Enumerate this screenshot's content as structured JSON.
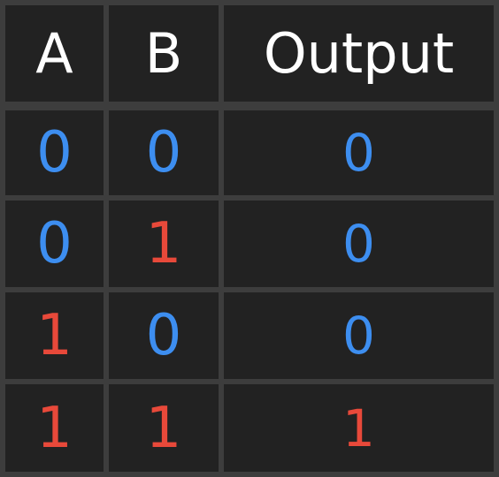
{
  "headers": [
    "A",
    "B",
    "Output"
  ],
  "rows": [
    [
      "0",
      "0",
      "0"
    ],
    [
      "0",
      "1",
      "0"
    ],
    [
      "1",
      "0",
      "0"
    ],
    [
      "1",
      "1",
      "1"
    ]
  ],
  "colors": {
    "zero": "#3d8ef0",
    "one": "#e8493a",
    "header_text": "#ffffff",
    "cell_bg": "#222222",
    "grid_lines": "#3d3d3d"
  }
}
